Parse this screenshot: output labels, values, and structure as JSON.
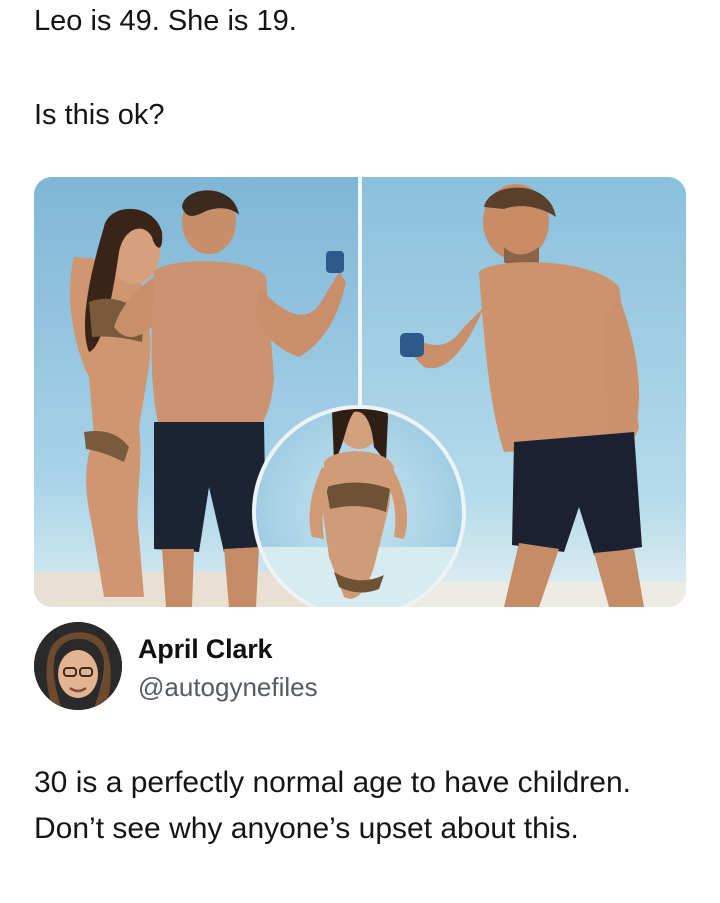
{
  "post": {
    "line1": "Leo is 49. She is 19.",
    "line2": "Is this ok?"
  },
  "author": {
    "name": "April Clark",
    "handle": "@autogynefiles"
  },
  "reply": {
    "text": "30 is a perfectly normal age to have children. Don’t see why anyone’s upset about this."
  },
  "colors": {
    "sea": "#8fc3df",
    "sand": "#e9e2d6",
    "skin": "#d9a47e",
    "shorts": "#1c2333"
  }
}
